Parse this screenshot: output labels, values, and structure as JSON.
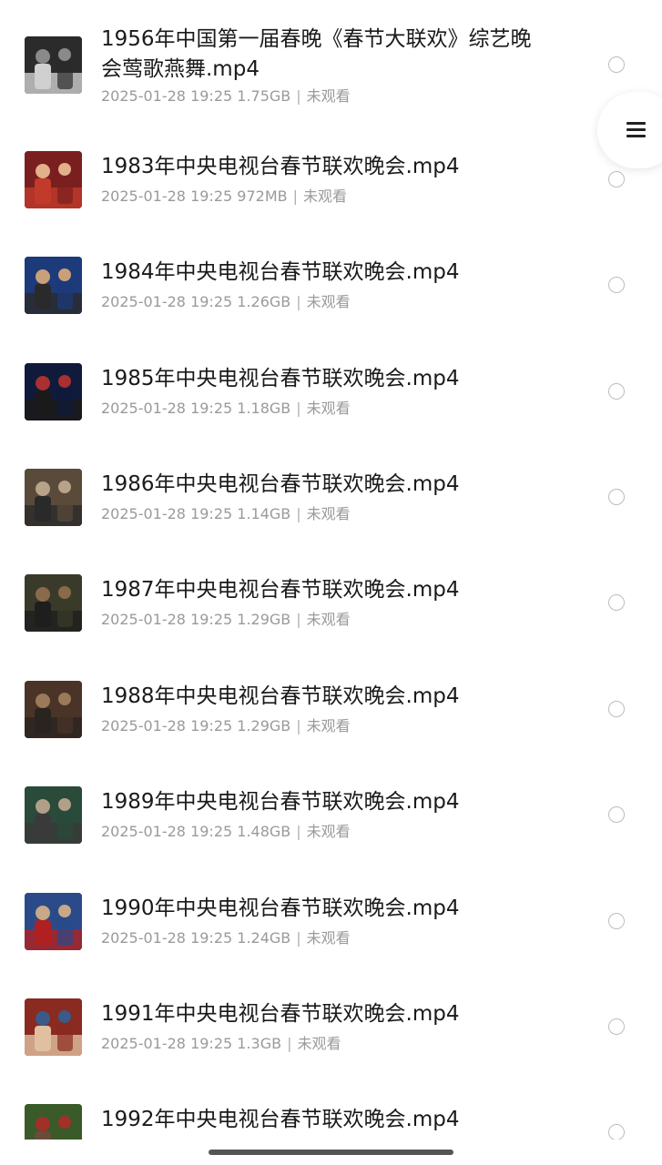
{
  "menu_button": {
    "icon": "hamburger-menu-icon"
  },
  "files": [
    {
      "title": "1956年中国第一届春晚《春节大联欢》综艺晚会莺歌燕舞.mp4",
      "date": "2025-01-28 19:25",
      "size": "1.75GB",
      "status": "未观看",
      "thumb_colors": [
        "#2b2b2b",
        "#8a8a8a",
        "#d0d0d0"
      ]
    },
    {
      "title": "1983年中央电视台春节联欢晚会.mp4",
      "date": "2025-01-28 19:25",
      "size": "972MB",
      "status": "未观看",
      "thumb_colors": [
        "#7a1f1f",
        "#e2b08a",
        "#c23a2a"
      ]
    },
    {
      "title": "1984年中央电视台春节联欢晚会.mp4",
      "date": "2025-01-28 19:25",
      "size": "1.26GB",
      "status": "未观看",
      "thumb_colors": [
        "#1d3a7a",
        "#c9a07a",
        "#2a2a2a"
      ]
    },
    {
      "title": "1985年中央电视台春节联欢晚会.mp4",
      "date": "2025-01-28 19:25",
      "size": "1.18GB",
      "status": "未观看",
      "thumb_colors": [
        "#101a3a",
        "#a83030",
        "#1a1a1a"
      ]
    },
    {
      "title": "1986年中央电视台春节联欢晚会.mp4",
      "date": "2025-01-28 19:25",
      "size": "1.14GB",
      "status": "未观看",
      "thumb_colors": [
        "#5a4a3a",
        "#b8a28a",
        "#2a2a2a"
      ]
    },
    {
      "title": "1987年中央电视台春节联欢晚会.mp4",
      "date": "2025-01-28 19:25",
      "size": "1.29GB",
      "status": "未观看",
      "thumb_colors": [
        "#3a3a2a",
        "#8a6a4a",
        "#1e1e1e"
      ]
    },
    {
      "title": "1988年中央电视台春节联欢晚会.mp4",
      "date": "2025-01-28 19:25",
      "size": "1.29GB",
      "status": "未观看",
      "thumb_colors": [
        "#4a3428",
        "#9a7a5a",
        "#2a2420"
      ]
    },
    {
      "title": "1989年中央电视台春节联欢晚会.mp4",
      "date": "2025-01-28 19:25",
      "size": "1.48GB",
      "status": "未观看",
      "thumb_colors": [
        "#2a4a3a",
        "#b0a08a",
        "#3a3a3a"
      ]
    },
    {
      "title": "1990年中央电视台春节联欢晚会.mp4",
      "date": "2025-01-28 19:25",
      "size": "1.24GB",
      "status": "未观看",
      "thumb_colors": [
        "#2a4a8a",
        "#c8a888",
        "#b02020"
      ]
    },
    {
      "title": "1991年中央电视台春节联欢晚会.mp4",
      "date": "2025-01-28 19:25",
      "size": "1.3GB",
      "status": "未观看",
      "thumb_colors": [
        "#8a2a20",
        "#3a5a8a",
        "#e0c0a0"
      ]
    },
    {
      "title": "1992年中央电视台春节联欢晚会.mp4",
      "date": "",
      "size": "",
      "status": "",
      "thumb_colors": [
        "#3a5a2a",
        "#a03028",
        "#6a4a3a"
      ]
    }
  ]
}
